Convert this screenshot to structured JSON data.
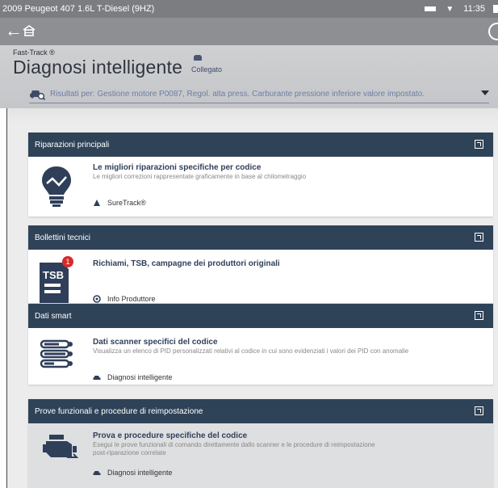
{
  "status": {
    "vehicle_title": "2009 Peugeot 407 1.6L T-Diesel (9HZ)",
    "time": "11:35"
  },
  "header": {
    "fast_track": "Fast-Track ®",
    "page_title": "Diagnosi intelligente",
    "connection": "Collegato",
    "results_filter": "Risultati per: Gestione motore P0087, Regol. alta press. Carburante pressione inferiore valore impostato."
  },
  "cards": [
    {
      "header": "Riparazioni principali",
      "title": "Le migliori riparazioni specifiche per codice",
      "description": "Le migliori correzioni rappresentate graficamente in base al chilometraggio",
      "link": "SureTrack®"
    },
    {
      "header": "Bollettini tecnici",
      "title": "Richiami, TSB, campagne dei produttori originali",
      "icon_label": "TSB",
      "badge": "1",
      "link": "Info Produttore"
    },
    {
      "header": "Dati smart",
      "title": "Dati scanner specifici del codice",
      "description": "Visualizza un elenco di PID personalizzati relativi al codice in cui sono evidenziati i valori dei PID con anomalie",
      "link": "Diagnosi intelligente"
    },
    {
      "header": "Prove funzionali e procedure di reimpostazione",
      "title": "Prova e procedure specifiche del codice",
      "description_line1": "Esegui le prove funzionali di comando direttamente dallo scanner e le procedure di reimpostazione",
      "description_line2": "post-riparazione correlate",
      "link": "Diagnosi intelligente"
    }
  ],
  "icons": {
    "back": "back-arrow-icon",
    "home": "home-icon",
    "settings": "settings-icon",
    "connected": "connected-icon",
    "vehicle": "vehicle-scan-icon",
    "dropdown": "chevron-down-icon",
    "expand": "expand-icon"
  },
  "colors": {
    "card_header": "#2f4358",
    "app_bar": "#8e8f92",
    "badge": "#d62b2b",
    "link_text": "#6c7fa2"
  }
}
